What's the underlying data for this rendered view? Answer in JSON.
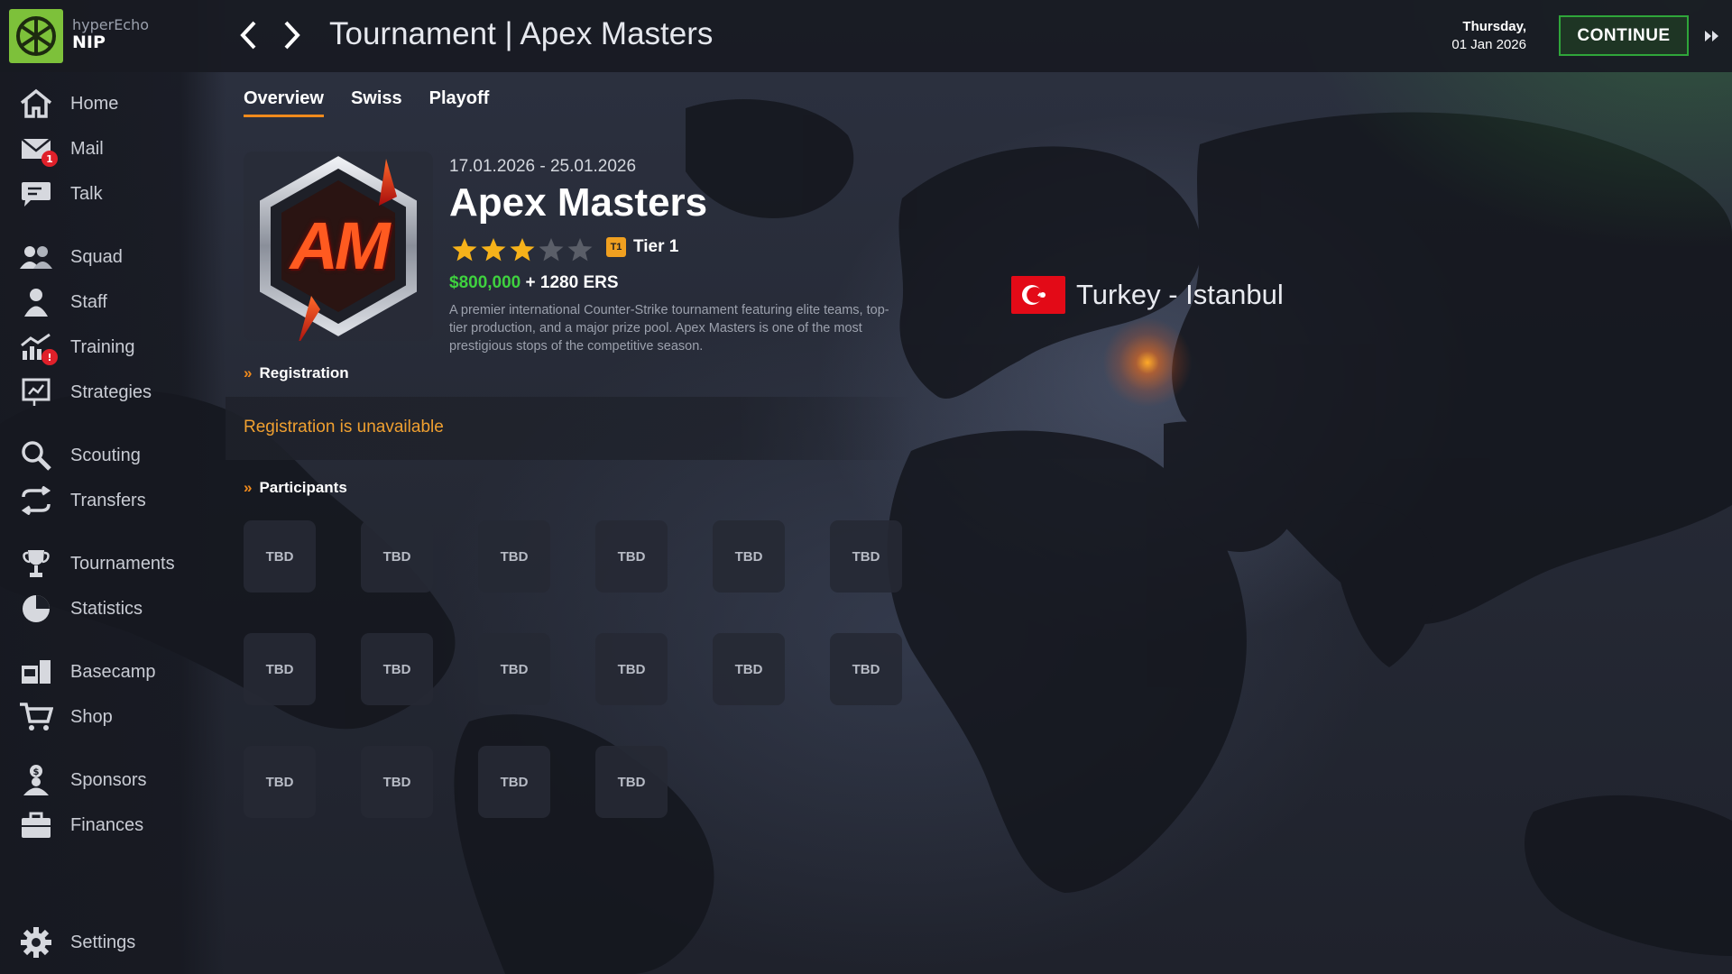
{
  "team": {
    "user": "hyperEcho",
    "name": "NIP"
  },
  "header": {
    "title": "Tournament | Apex Masters",
    "day": "Thursday,",
    "date": "01 Jan 2026",
    "continue_label": "CONTINUE"
  },
  "sidebar": {
    "items": [
      {
        "label": "Home",
        "icon": "home-icon"
      },
      {
        "label": "Mail",
        "icon": "mail-icon",
        "badge": "1"
      },
      {
        "label": "Talk",
        "icon": "chat-icon"
      },
      {
        "label": "Squad",
        "icon": "squad-icon"
      },
      {
        "label": "Staff",
        "icon": "staff-icon"
      },
      {
        "label": "Training",
        "icon": "training-icon",
        "badge": "!"
      },
      {
        "label": "Strategies",
        "icon": "strategies-icon"
      },
      {
        "label": "Scouting",
        "icon": "scouting-icon"
      },
      {
        "label": "Transfers",
        "icon": "transfers-icon"
      },
      {
        "label": "Tournaments",
        "icon": "trophy-icon"
      },
      {
        "label": "Statistics",
        "icon": "pie-chart-icon"
      },
      {
        "label": "Basecamp",
        "icon": "basecamp-icon"
      },
      {
        "label": "Shop",
        "icon": "cart-icon"
      },
      {
        "label": "Sponsors",
        "icon": "sponsor-icon"
      },
      {
        "label": "Finances",
        "icon": "briefcase-icon"
      },
      {
        "label": "Settings",
        "icon": "gear-icon"
      }
    ]
  },
  "tabs": [
    "Overview",
    "Swiss",
    "Playoff"
  ],
  "tournament": {
    "dates": "17.01.2026 - 25.01.2026",
    "name": "Apex Masters",
    "logo_text": "AM",
    "stars": 3,
    "stars_max": 5,
    "tier_badge": "T1",
    "tier": "Tier 1",
    "prize_money": "$800,000",
    "prize_ers": "+ 1280 ERS",
    "description": "A premier international Counter-Strike tournament featuring elite teams, top-tier production, and a major prize pool. Apex Masters is one of the most prestigious stops of the competitive season.",
    "location": "Turkey - Istanbul"
  },
  "registration": {
    "heading": "Registration",
    "status": "Registration is unavailable"
  },
  "participants": {
    "heading": "Participants",
    "slots": [
      "TBD",
      "TBD",
      "TBD",
      "TBD",
      "TBD",
      "TBD",
      "TBD",
      "TBD",
      "TBD",
      "TBD",
      "TBD",
      "TBD",
      "TBD",
      "TBD",
      "TBD",
      "TBD"
    ]
  },
  "colors": {
    "accent": "#f08a1c",
    "continue": "#2fa63a",
    "prize": "#3fd13f",
    "warning": "#f0a030"
  }
}
